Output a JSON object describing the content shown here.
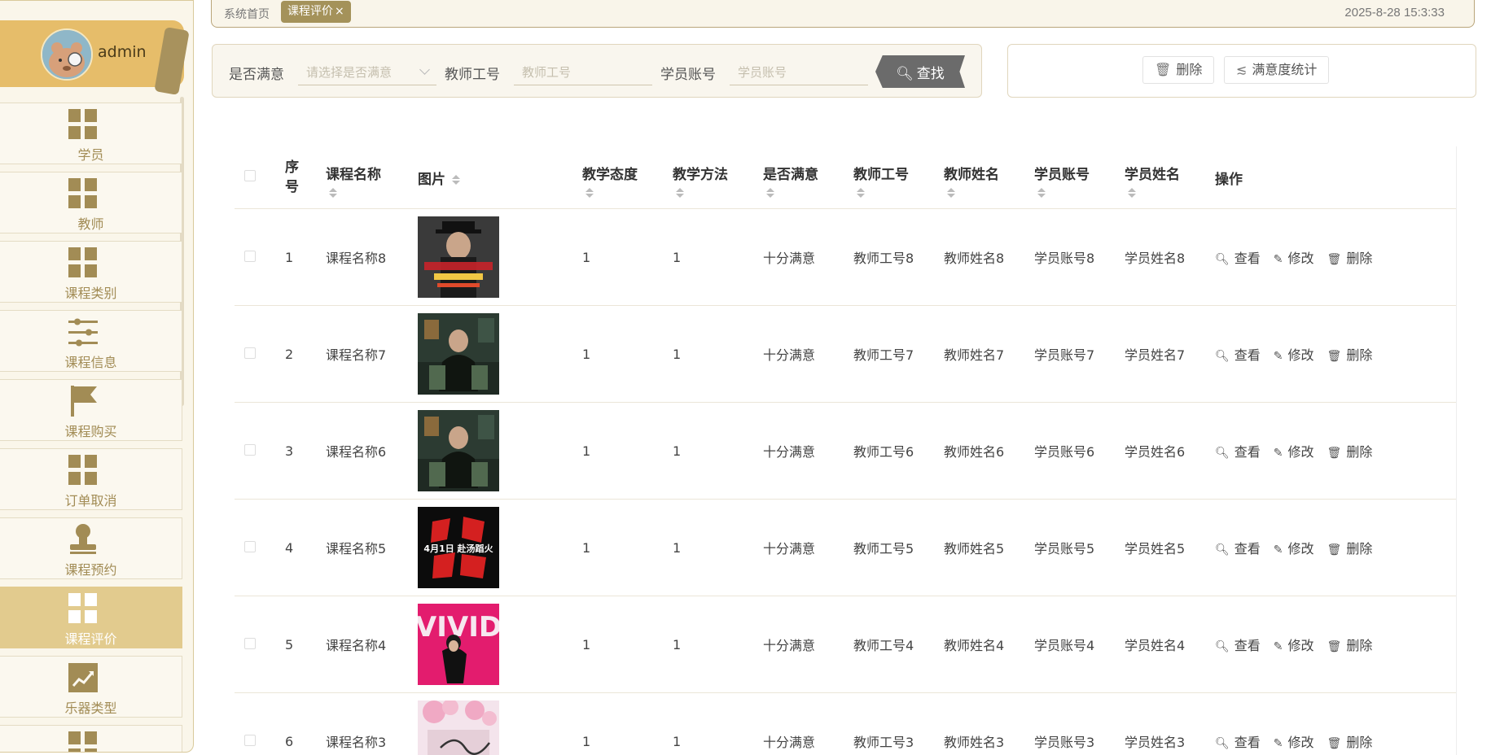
{
  "user": {
    "name": "admin"
  },
  "sidebar": {
    "items": [
      {
        "label": "学员",
        "icon": "grid-icon"
      },
      {
        "label": "教师",
        "icon": "grid-icon"
      },
      {
        "label": "课程类别",
        "icon": "grid-icon"
      },
      {
        "label": "课程信息",
        "icon": "sliders-icon"
      },
      {
        "label": "课程购买",
        "icon": "flag-icon"
      },
      {
        "label": "订单取消",
        "icon": "grid-icon"
      },
      {
        "label": "课程预约",
        "icon": "stamp-icon"
      },
      {
        "label": "课程评价",
        "icon": "grid-icon",
        "active": true
      },
      {
        "label": "乐器类型",
        "icon": "trend-icon"
      }
    ]
  },
  "topbar": {
    "home": "系统首页",
    "active_tab": "课程评价",
    "close_icon": "×",
    "datetime": "2025-8-28 15:3:33"
  },
  "search": {
    "satisfied_label": "是否满意",
    "satisfied_placeholder": "请选择是否满意",
    "teacher_no_label": "教师工号",
    "teacher_no_placeholder": "教师工号",
    "student_acct_label": "学员账号",
    "student_acct_placeholder": "学员账号",
    "button": "查找"
  },
  "actions": {
    "delete": "删除",
    "stats": "满意度统计"
  },
  "table": {
    "headers": {
      "index": "序号",
      "course_name": "课程名称",
      "image": "图片",
      "attitude": "教学态度",
      "method": "教学方法",
      "satisfied": "是否满意",
      "teacher_no": "教师工号",
      "teacher_name": "教师姓名",
      "student_acct": "学员账号",
      "student_name": "学员姓名",
      "ops": "操作"
    },
    "op_labels": {
      "view": "查看",
      "edit": "修改",
      "delete": "删除"
    },
    "rows": [
      {
        "index": "1",
        "course_name": "课程名称8",
        "image": "poster-man-hat",
        "attitude": "1",
        "method": "1",
        "satisfied": "十分满意",
        "teacher_no": "教师工号8",
        "teacher_name": "教师姓名8",
        "student_acct": "学员账号8",
        "student_name": "学员姓名8"
      },
      {
        "index": "2",
        "course_name": "课程名称7",
        "image": "poster-green-room",
        "attitude": "1",
        "method": "1",
        "satisfied": "十分满意",
        "teacher_no": "教师工号7",
        "teacher_name": "教师姓名7",
        "student_acct": "学员账号7",
        "student_name": "学员姓名7"
      },
      {
        "index": "3",
        "course_name": "课程名称6",
        "image": "poster-green-room",
        "attitude": "1",
        "method": "1",
        "satisfied": "十分满意",
        "teacher_no": "教师工号6",
        "teacher_name": "教师姓名6",
        "student_acct": "学员账号6",
        "student_name": "学员姓名6"
      },
      {
        "index": "4",
        "course_name": "课程名称5",
        "image": "poster-red-black",
        "attitude": "1",
        "method": "1",
        "satisfied": "十分满意",
        "teacher_no": "教师工号5",
        "teacher_name": "教师姓名5",
        "student_acct": "学员账号5",
        "student_name": "学员姓名5"
      },
      {
        "index": "5",
        "course_name": "课程名称4",
        "image": "poster-pink-vivid",
        "attitude": "1",
        "method": "1",
        "satisfied": "十分满意",
        "teacher_no": "教师工号4",
        "teacher_name": "教师姓名4",
        "student_acct": "学员账号4",
        "student_name": "学员姓名4"
      },
      {
        "index": "6",
        "course_name": "课程名称3",
        "image": "poster-pink-blossom",
        "attitude": "1",
        "method": "1",
        "satisfied": "十分满意",
        "teacher_no": "教师工号3",
        "teacher_name": "教师姓名3",
        "student_acct": "学员账号3",
        "student_name": "学员姓名3"
      }
    ]
  },
  "poster_text": {
    "poster-red-black": "4月1日 赴汤蹈火",
    "poster-pink-vivid": "VIVID"
  },
  "colors": {
    "accent": "#a4925a",
    "sidebar_active": "#e2cb8e",
    "userbox": "#e6bd6a",
    "search_button": "#6b6b6b"
  }
}
